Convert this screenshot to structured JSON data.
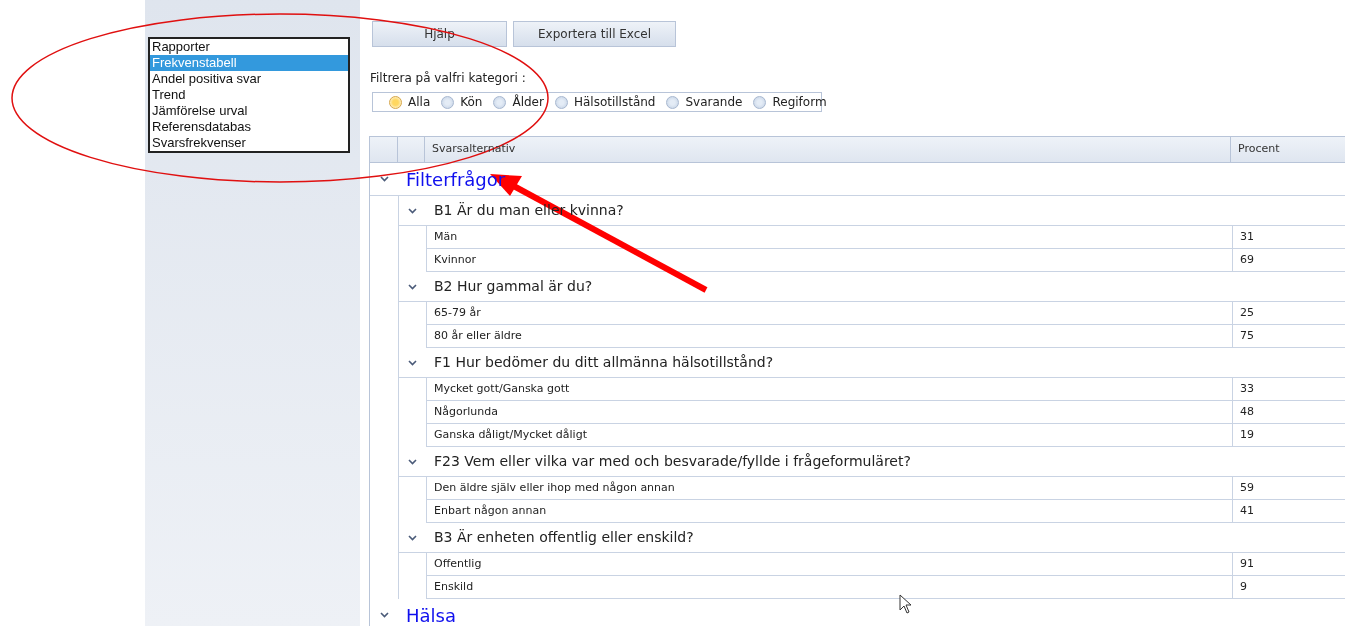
{
  "view_list": {
    "items": [
      {
        "label": "Rapporter",
        "selected": false
      },
      {
        "label": "Frekvenstabell",
        "selected": true
      },
      {
        "label": "Andel positiva svar",
        "selected": false
      },
      {
        "label": "Trend",
        "selected": false
      },
      {
        "label": "Jämförelse urval",
        "selected": false
      },
      {
        "label": "Referensdatabas",
        "selected": false
      },
      {
        "label": "Svarsfrekvenser",
        "selected": false
      }
    ]
  },
  "buttons": [
    "Hjälp",
    "Exportera till Excel"
  ],
  "filter": {
    "label": "Filtrera på valfri kategori :",
    "options": [
      {
        "label": "Alla",
        "selected": true
      },
      {
        "label": "Kön",
        "selected": false
      },
      {
        "label": "Ålder",
        "selected": false
      },
      {
        "label": "Hälsotillstånd",
        "selected": false
      },
      {
        "label": "Svarande",
        "selected": false
      },
      {
        "label": "Regiform",
        "selected": false
      }
    ]
  },
  "table": {
    "columns": [
      "Svarsalternativ",
      "Procent"
    ],
    "groups": [
      {
        "title": "Filterfrågor",
        "expanded": true,
        "children": [
          {
            "title": "B1 Är du man eller kvinna?",
            "expanded": true,
            "children": [
              {
                "answer": "Män",
                "percent": "31"
              },
              {
                "answer": "Kvinnor",
                "percent": "69"
              }
            ]
          },
          {
            "title": "B2 Hur gammal är du?",
            "expanded": true,
            "children": [
              {
                "answer": "65-79 år",
                "percent": "25"
              },
              {
                "answer": "80 år eller äldre",
                "percent": "75"
              }
            ]
          },
          {
            "title": "F1 Hur bedömer du ditt allmänna hälsotillstånd?",
            "expanded": true,
            "children": [
              {
                "answer": "Mycket gott/Ganska gott",
                "percent": "33"
              },
              {
                "answer": "Någorlunda",
                "percent": "48"
              },
              {
                "answer": "Ganska dåligt/Mycket dåligt",
                "percent": "19"
              }
            ]
          },
          {
            "title": "F23 Vem eller vilka var med och besvarade/fyllde i frågeformuläret?",
            "expanded": true,
            "children": [
              {
                "answer": "Den äldre själv eller ihop med någon annan",
                "percent": "59"
              },
              {
                "answer": "Enbart någon annan",
                "percent": "41"
              }
            ]
          },
          {
            "title": "B3 Är enheten offentlig eller enskild?",
            "expanded": true,
            "children": [
              {
                "answer": "Offentlig",
                "percent": "91"
              },
              {
                "answer": "Enskild",
                "percent": "9"
              }
            ]
          }
        ]
      },
      {
        "title": "Hälsa",
        "expanded": true
      }
    ]
  }
}
